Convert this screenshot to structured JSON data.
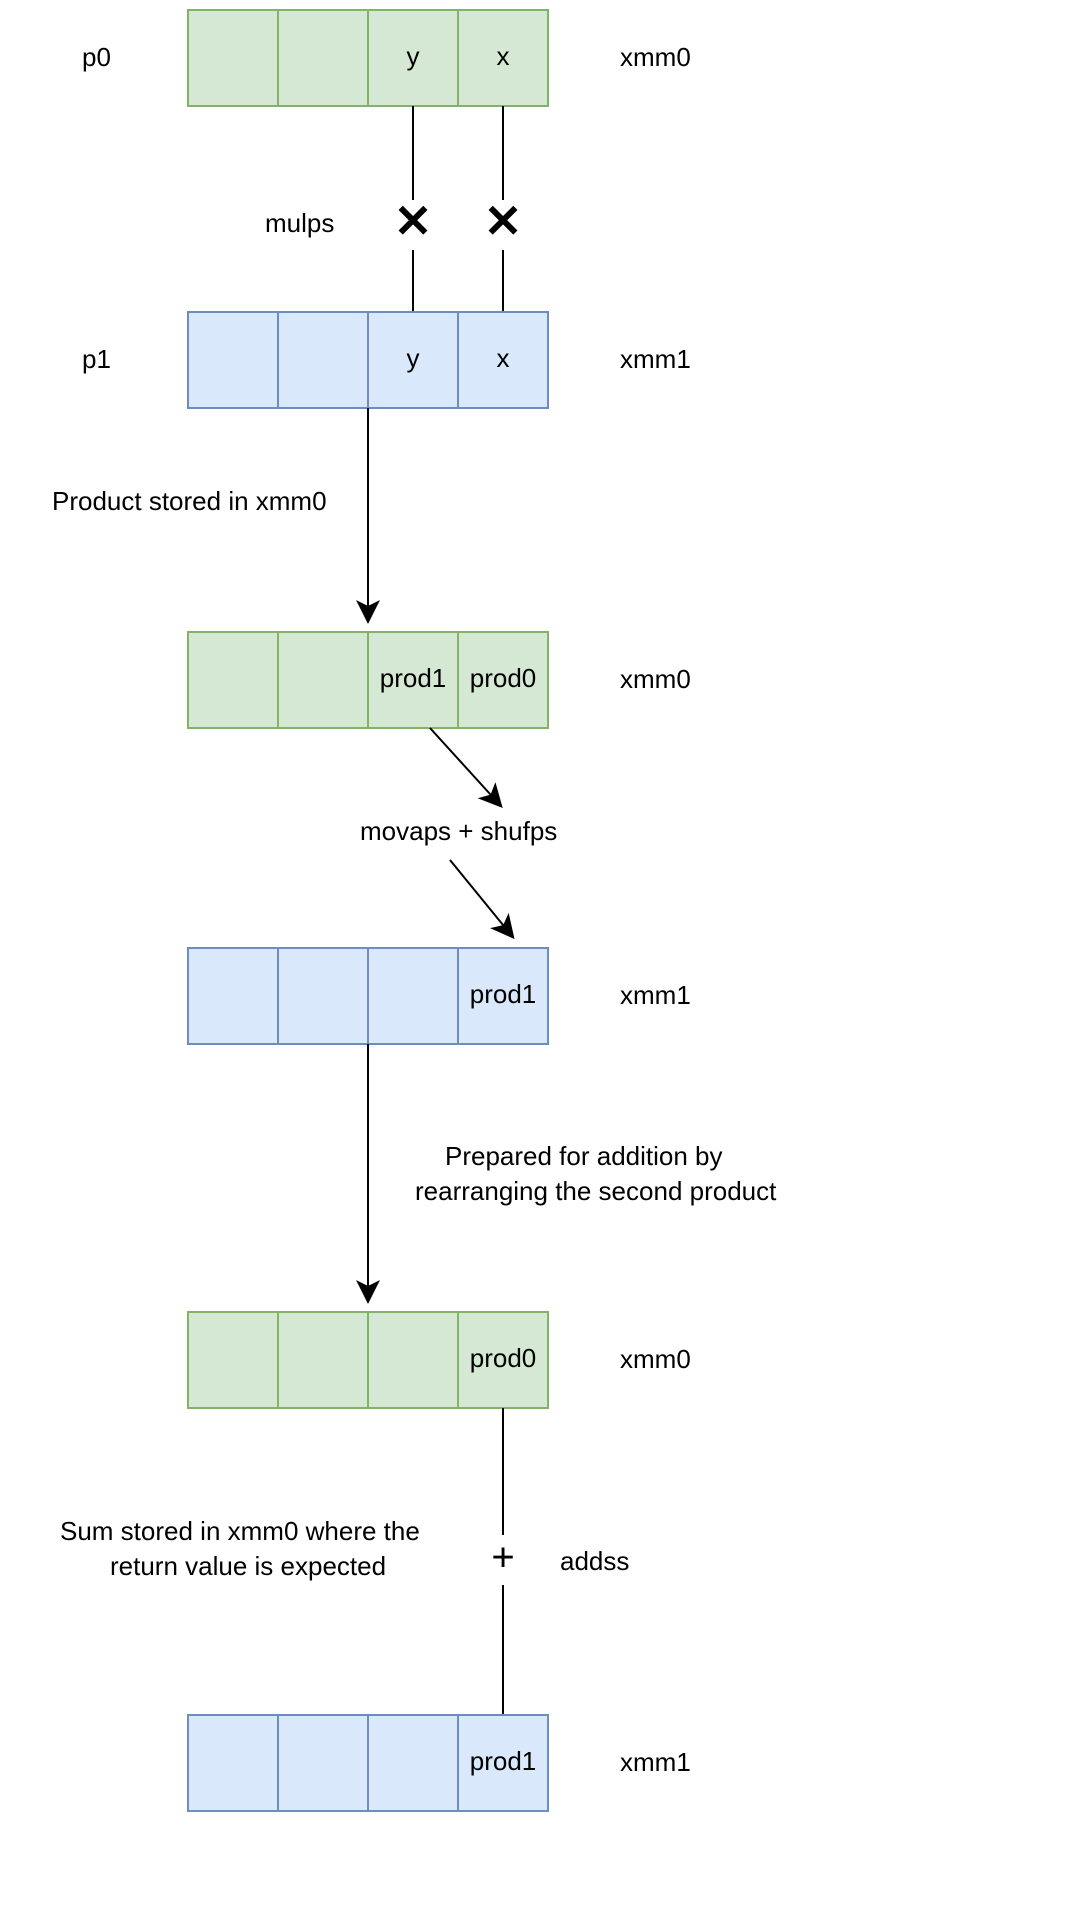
{
  "colors": {
    "green_fill": "#d5e8d4",
    "green_stroke": "#82b366",
    "blue_fill": "#dae8fc",
    "blue_stroke": "#6c8ebf"
  },
  "registers": {
    "r1": {
      "left_label": "p0",
      "right_label": "xmm0",
      "cells": [
        "",
        "",
        "y",
        "x"
      ],
      "color": "green"
    },
    "r2": {
      "left_label": "p1",
      "right_label": "xmm1",
      "cells": [
        "",
        "",
        "y",
        "x"
      ],
      "color": "blue"
    },
    "r3": {
      "left_label": "",
      "right_label": "xmm0",
      "cells": [
        "",
        "",
        "prod1",
        "prod0"
      ],
      "color": "green"
    },
    "r4": {
      "left_label": "",
      "right_label": "xmm1",
      "cells": [
        "",
        "",
        "",
        "prod1"
      ],
      "color": "blue"
    },
    "r5": {
      "left_label": "",
      "right_label": "xmm0",
      "cells": [
        "",
        "",
        "",
        "prod0"
      ],
      "color": "green"
    },
    "r6": {
      "left_label": "",
      "right_label": "xmm1",
      "cells": [
        "",
        "",
        "",
        "prod1"
      ],
      "color": "blue"
    }
  },
  "ops": {
    "mulps": "mulps",
    "movaps_shufps": "movaps + shufps",
    "addss": "addss"
  },
  "notes": {
    "product_stored": "Product stored in xmm0",
    "prepared_l1": "Prepared for addition by",
    "prepared_l2": "rearranging the second product",
    "sum_l1": "Sum stored in xmm0 where the",
    "sum_l2": "return value is expected"
  }
}
